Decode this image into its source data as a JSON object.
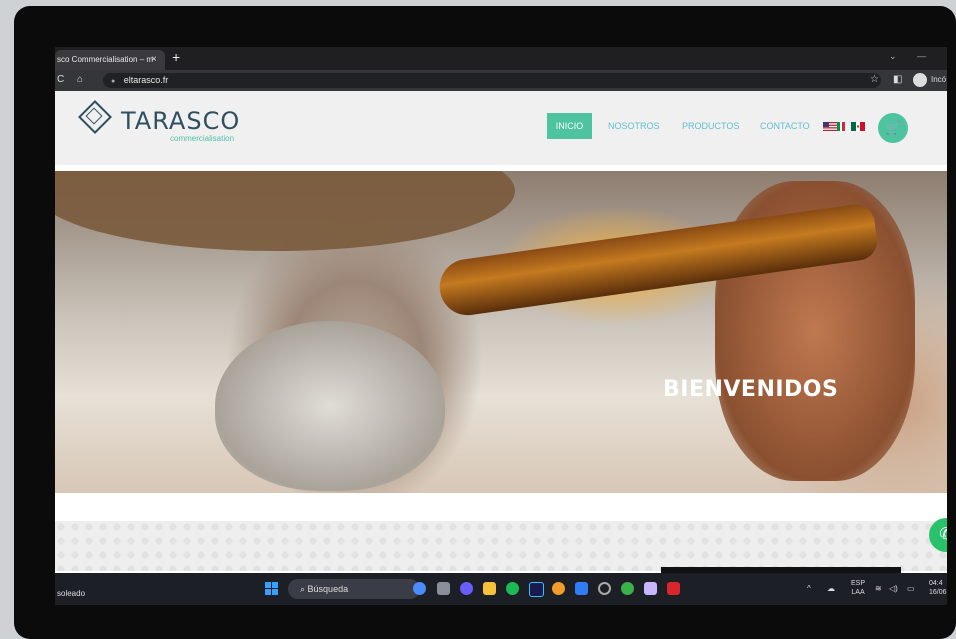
{
  "browser": {
    "tab_title": "sco Commercialisation – m",
    "tab_close": "×",
    "new_tab": "+",
    "url": "eltarasco.fr",
    "profile_label": "Incó"
  },
  "site": {
    "logo_text": "TARASCO",
    "logo_sub": "commercialisation",
    "nav": [
      {
        "label": "INICIO",
        "active": true
      },
      {
        "label": "NOSOTROS",
        "active": false
      },
      {
        "label": "PRODUCTOS",
        "active": false
      },
      {
        "label": "CONTACTO",
        "active": false
      }
    ],
    "flags": [
      "us-flag",
      "it-flag",
      "mx-flag"
    ],
    "cart_icon": "cart-icon"
  },
  "hero": {
    "title": "BIENVENIDOS"
  },
  "taskbar": {
    "weather": "soleado",
    "search_placeholder": "Búsqueda",
    "lang_top": "ESP",
    "lang_bottom": "LAA",
    "time": "04:4",
    "date": "16/06"
  },
  "colors": {
    "accent": "#4ec3a0",
    "nav_text": "#5fbfd0",
    "logo": "#2f4f60",
    "whatsapp": "#29c26a"
  }
}
